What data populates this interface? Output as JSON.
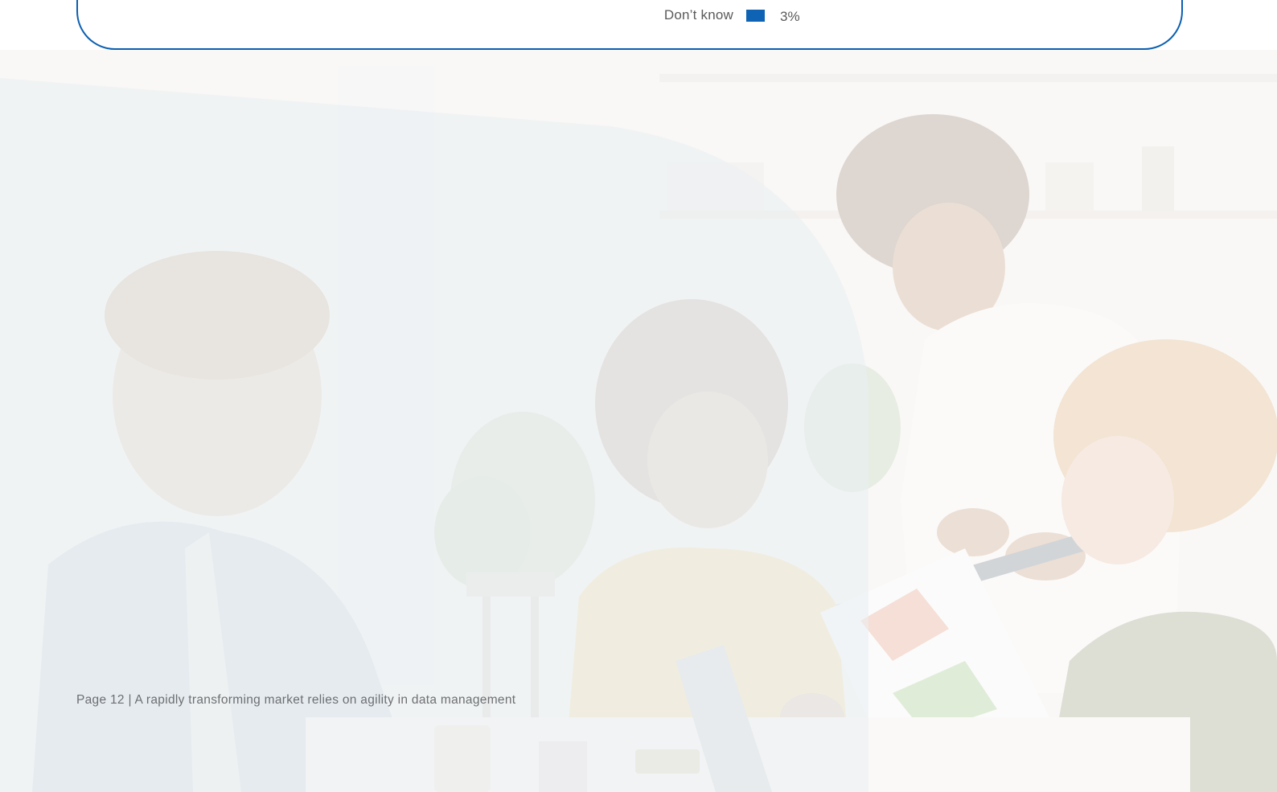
{
  "legend": {
    "label": "Don’t know",
    "value": "3%",
    "bar_color": "#0e63b5"
  },
  "panel": {
    "border_color": "#0b5fb0"
  },
  "footer": {
    "text": "Page 12 | A rapidly transforming market relies on agility in data management"
  }
}
